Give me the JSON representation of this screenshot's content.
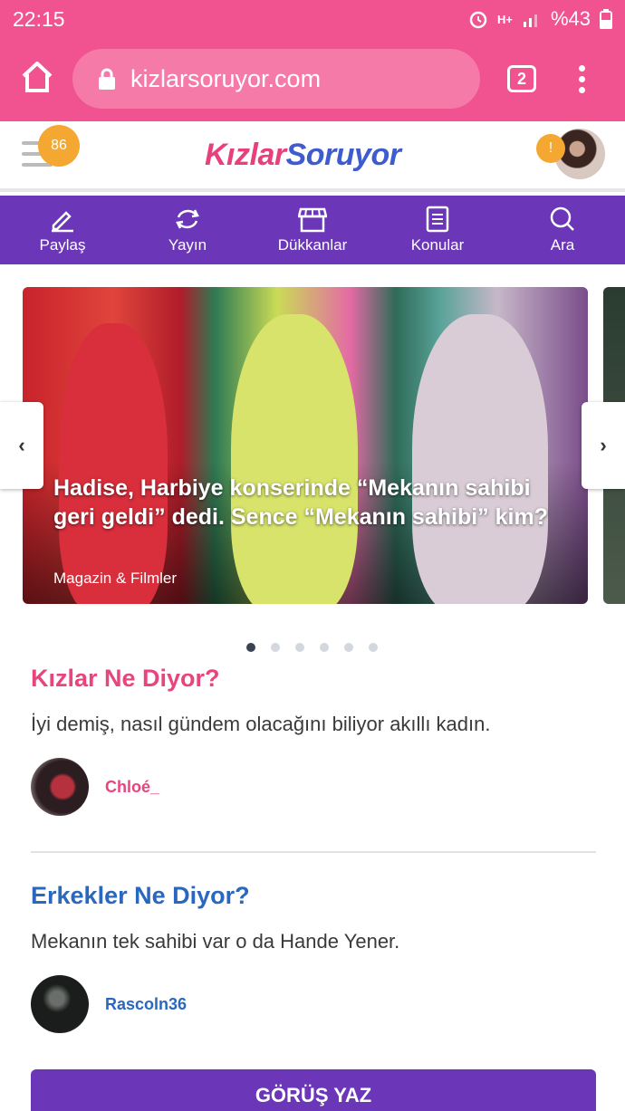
{
  "status_bar": {
    "time": "22:15",
    "network": "H+",
    "battery": "%43"
  },
  "browser": {
    "url": "kizlarsoruyor.com",
    "tab_count": "2"
  },
  "header": {
    "notification_count": "86",
    "logo_part1": "Kızlar",
    "logo_part2": "Soruyor",
    "alert_symbol": "!"
  },
  "nav": [
    {
      "label": "Paylaş",
      "icon": "pencil-icon"
    },
    {
      "label": "Yayın",
      "icon": "refresh-icon"
    },
    {
      "label": "Dükkanlar",
      "icon": "store-icon"
    },
    {
      "label": "Konular",
      "icon": "list-icon"
    },
    {
      "label": "Ara",
      "icon": "search-icon"
    }
  ],
  "carousel": {
    "title": "Hadise, Harbiye konserinde “Mekanın sahibi geri geldi” dedi. Sence “Mekanın sahibi” kim?",
    "category": "Magazin & Filmler",
    "prev": "‹",
    "next": "›",
    "slide_count": 6,
    "active_index": 0
  },
  "girls": {
    "title": "Kızlar Ne Diyor?",
    "text": "İyi demiş, nasıl gündem olacağını biliyor akıllı kadın.",
    "username": "Chloé_"
  },
  "boys": {
    "title": "Erkekler Ne Diyor?",
    "text": "Mekanın tek sahibi var o da Hande Yener.",
    "username": "Rascoln36"
  },
  "cta": {
    "label": "GÖRÜŞ YAZ"
  },
  "colors": {
    "pink": "#f0538f",
    "purple": "#6b36b8",
    "girls": "#e8457f",
    "boys": "#2a67bf",
    "badge": "#f4a731"
  }
}
